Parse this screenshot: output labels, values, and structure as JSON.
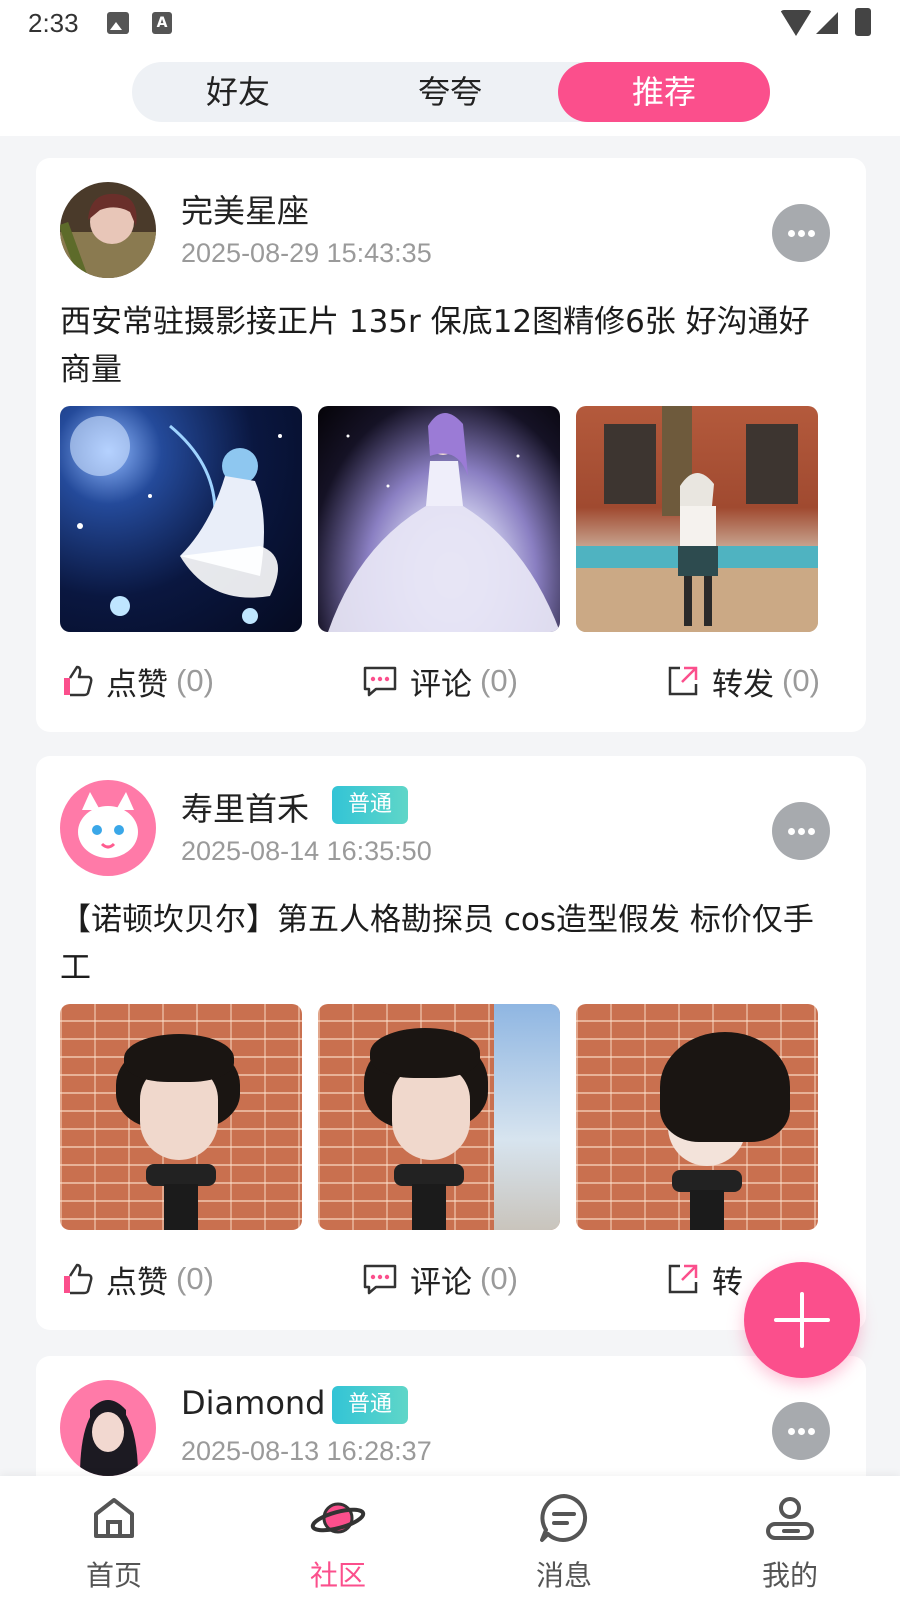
{
  "status_bar": {
    "time": "2:33"
  },
  "top_tabs": [
    {
      "label": "好友",
      "active": false
    },
    {
      "label": "夸夸",
      "active": false
    },
    {
      "label": "推荐",
      "active": true
    }
  ],
  "accent_color": "#fb4f8c",
  "badge_color": "#33c4d6",
  "posts": [
    {
      "username": "完美星座",
      "badge": "",
      "timestamp": "2025-08-29 15:43:35",
      "text": "西安常驻摄影接正片 135r 保底12图精修6张 好沟通好商量",
      "actions": {
        "like_label": "点赞",
        "like_count": "(0)",
        "comment_label": "评论",
        "comment_count": "(0)",
        "share_label": "转发",
        "share_count": "(0)"
      }
    },
    {
      "username": "寿里首禾",
      "badge": "普通",
      "timestamp": "2025-08-14 16:35:50",
      "text": "【诺顿坎贝尔】第五人格勘探员 cos造型假发 标价仅手工",
      "actions": {
        "like_label": "点赞",
        "like_count": "(0)",
        "comment_label": "评论",
        "comment_count": "(0)",
        "share_label": "转",
        "share_count": ""
      }
    },
    {
      "username": "Diamond",
      "badge": "普通",
      "timestamp": "2025-08-13 16:28:37"
    }
  ],
  "bottom_nav": [
    {
      "label": "首页",
      "icon": "home-icon",
      "active": false
    },
    {
      "label": "社区",
      "icon": "planet-icon",
      "active": true
    },
    {
      "label": "消息",
      "icon": "message-icon",
      "active": false
    },
    {
      "label": "我的",
      "icon": "profile-icon",
      "active": false
    }
  ]
}
